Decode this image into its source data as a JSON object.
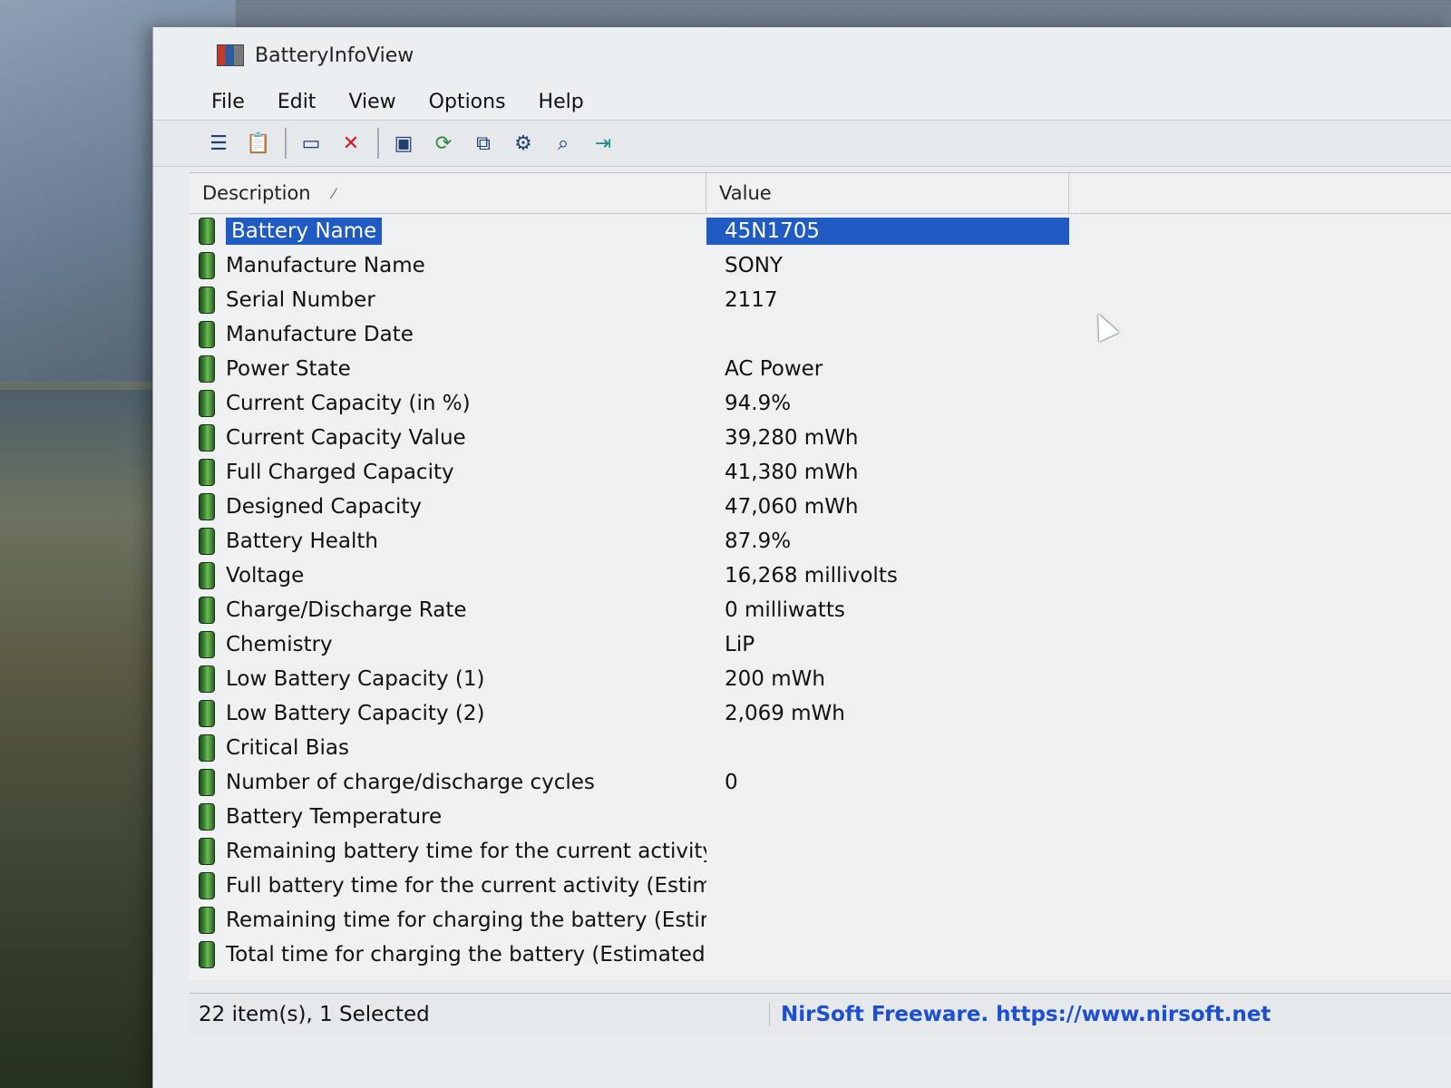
{
  "window": {
    "title": "BatteryInfoView"
  },
  "menu": [
    "File",
    "Edit",
    "View",
    "Options",
    "Help"
  ],
  "toolbar": {
    "icons": [
      "properties-icon",
      "clipboard-icon",
      "html-report-icon",
      "delete-icon",
      "save-icon",
      "refresh-icon",
      "copy-icon",
      "options-icon",
      "find-icon",
      "exit-icon"
    ]
  },
  "list": {
    "columns": {
      "description": "Description",
      "value": "Value"
    },
    "rows": [
      {
        "description": "Battery Name",
        "value": "45N1705",
        "selected": true
      },
      {
        "description": "Manufacture Name",
        "value": "SONY"
      },
      {
        "description": "Serial Number",
        "value": "2117"
      },
      {
        "description": "Manufacture Date",
        "value": ""
      },
      {
        "description": "Power State",
        "value": "AC Power"
      },
      {
        "description": "Current Capacity (in %)",
        "value": "94.9%"
      },
      {
        "description": "Current Capacity Value",
        "value": "39,280 mWh"
      },
      {
        "description": "Full Charged Capacity",
        "value": "41,380 mWh"
      },
      {
        "description": "Designed Capacity",
        "value": "47,060 mWh"
      },
      {
        "description": "Battery Health",
        "value": "87.9%"
      },
      {
        "description": "Voltage",
        "value": "16,268 millivolts"
      },
      {
        "description": "Charge/Discharge Rate",
        "value": "0 milliwatts"
      },
      {
        "description": "Chemistry",
        "value": "LiP"
      },
      {
        "description": "Low Battery Capacity (1)",
        "value": "200 mWh"
      },
      {
        "description": "Low Battery Capacity (2)",
        "value": "2,069 mWh"
      },
      {
        "description": "Critical Bias",
        "value": ""
      },
      {
        "description": "Number of charge/discharge cycles",
        "value": "0"
      },
      {
        "description": "Battery Temperature",
        "value": ""
      },
      {
        "description": "Remaining battery time for the current activity (Est...",
        "value": ""
      },
      {
        "description": "Full battery time for the current activity (Estimated)",
        "value": ""
      },
      {
        "description": "Remaining time for charging the battery (Estimated)",
        "value": ""
      },
      {
        "description": "Total  time for charging the battery (Estimated)",
        "value": ""
      }
    ]
  },
  "status": {
    "count": "22 item(s), 1 Selected",
    "link": "NirSoft Freeware. https://www.nirsoft.net"
  },
  "colors": {
    "selection": "#1f5bc2",
    "link": "#1d4fd0"
  }
}
